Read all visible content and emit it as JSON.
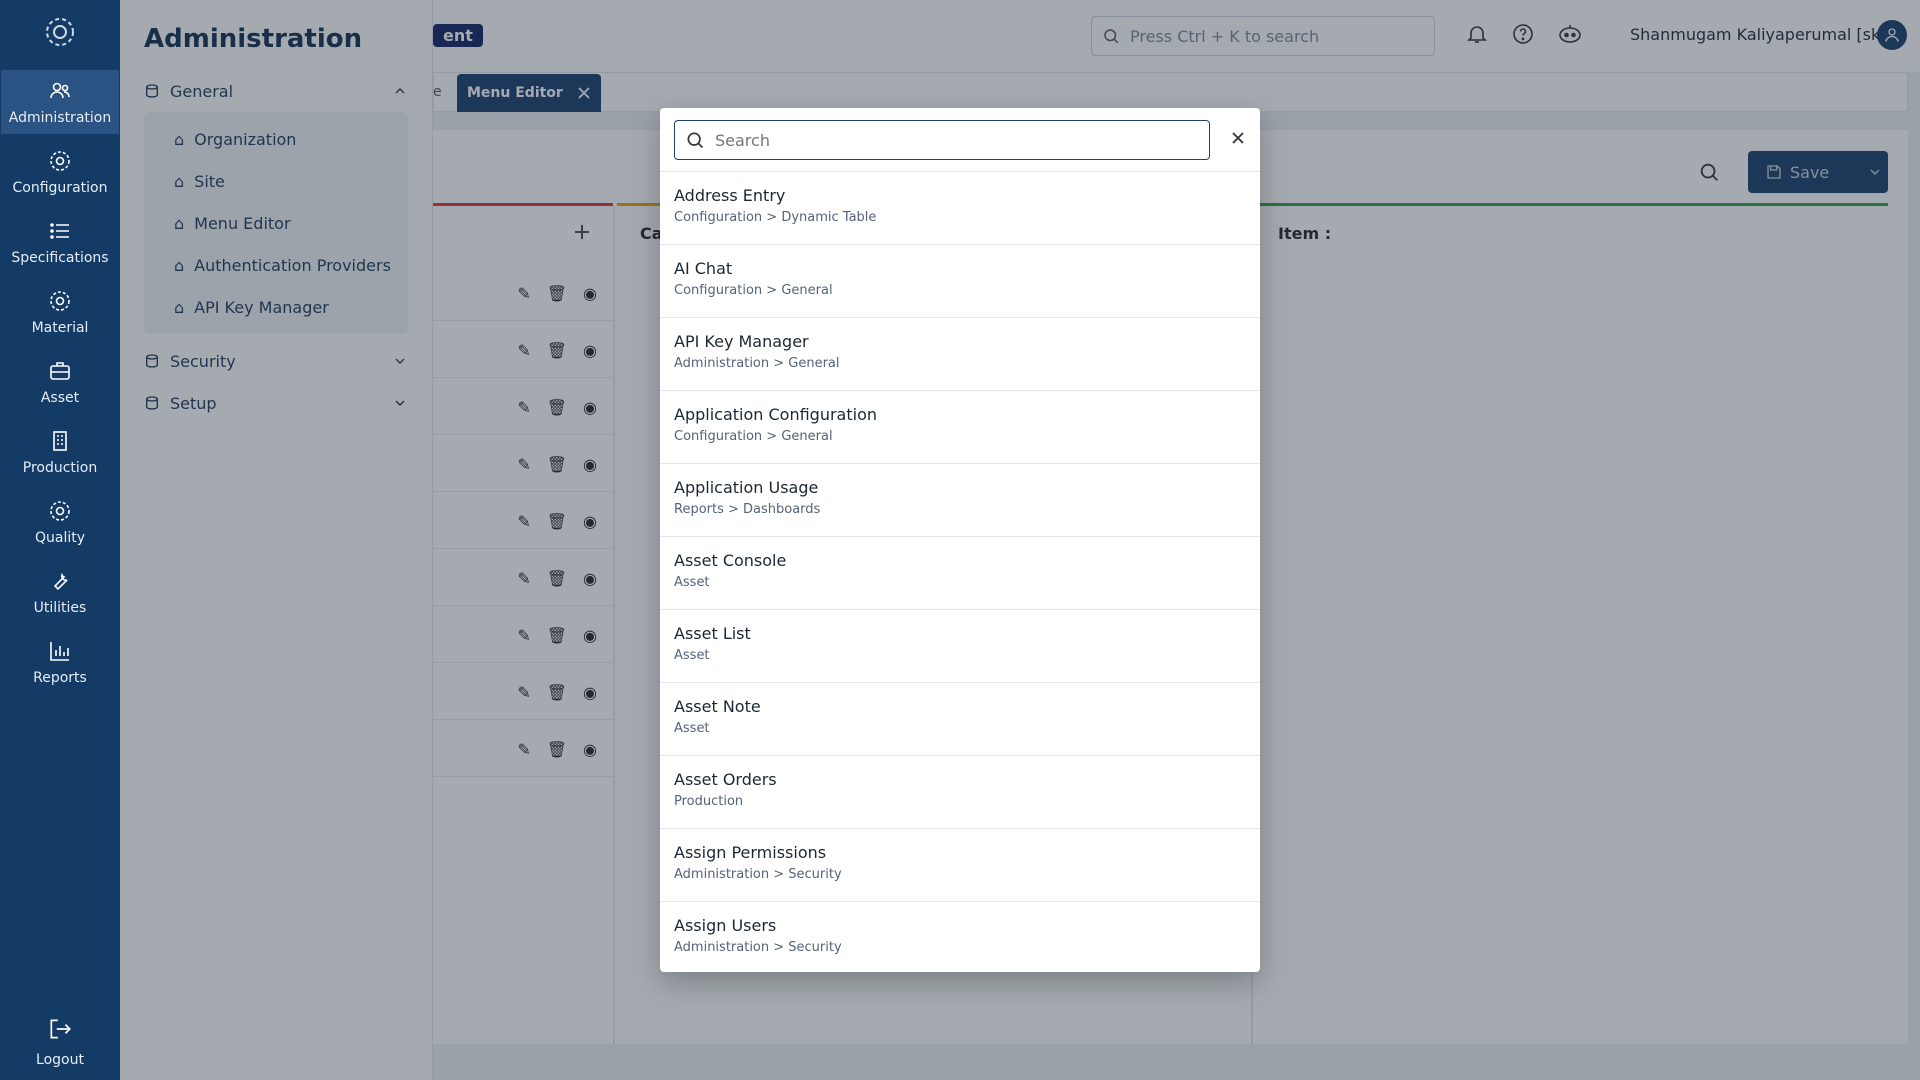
{
  "rail": {
    "items": [
      {
        "label": "Administration",
        "icon": "users-icon",
        "active": true
      },
      {
        "label": "Configuration",
        "icon": "gear-icon"
      },
      {
        "label": "Specifications",
        "icon": "list-icon"
      },
      {
        "label": "Material",
        "icon": "gear-icon"
      },
      {
        "label": "Asset",
        "icon": "briefcase-icon"
      },
      {
        "label": "Production",
        "icon": "building-icon"
      },
      {
        "label": "Quality",
        "icon": "gear-icon"
      },
      {
        "label": "Utilities",
        "icon": "wrench-icon"
      },
      {
        "label": "Reports",
        "icon": "bar-chart-icon"
      }
    ],
    "logout": "Logout"
  },
  "flyout": {
    "title": "Administration",
    "general": "General",
    "general_items": [
      "Organization",
      "Site",
      "Menu Editor",
      "Authentication Providers",
      "API Key Manager"
    ],
    "security": "Security",
    "setup": "Setup"
  },
  "topbar": {
    "env_badge": "ent",
    "search_placeholder": "Press Ctrl + K to search",
    "user_name": "Shanmugam Kaliyaperumal [sk]"
  },
  "tabs": {
    "stub": "e",
    "active": "Menu Editor"
  },
  "main": {
    "save_label": "Save",
    "col_label": "Ca",
    "item_label": "Item :"
  },
  "modal": {
    "search_placeholder": "Search",
    "results": [
      {
        "title": "Address Entry",
        "path": "Configuration > Dynamic Table"
      },
      {
        "title": "AI Chat",
        "path": "Configuration > General"
      },
      {
        "title": "API Key Manager",
        "path": "Administration > General"
      },
      {
        "title": "Application Configuration",
        "path": "Configuration > General"
      },
      {
        "title": "Application Usage",
        "path": "Reports > Dashboards"
      },
      {
        "title": "Asset Console",
        "path": "Asset"
      },
      {
        "title": "Asset List",
        "path": "Asset"
      },
      {
        "title": "Asset Note",
        "path": "Asset"
      },
      {
        "title": "Asset Orders",
        "path": "Production"
      },
      {
        "title": "Assign Permissions",
        "path": "Administration > Security"
      },
      {
        "title": "Assign Users",
        "path": "Administration > Security"
      }
    ]
  }
}
